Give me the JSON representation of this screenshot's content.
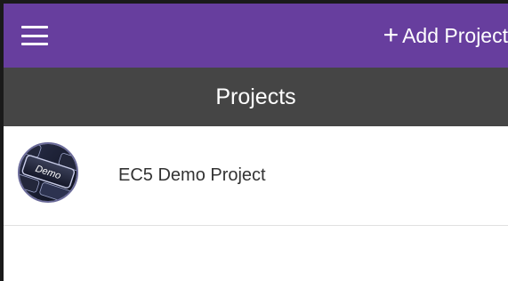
{
  "header": {
    "add_project_label": "Add Project",
    "add_icon": "plus-icon",
    "menu_icon": "hamburger-menu-icon"
  },
  "title_bar": {
    "title": "Projects"
  },
  "projects": [
    {
      "name": "EC5 Demo Project",
      "logo_text": "Demo"
    }
  ],
  "colors": {
    "app_bar": "#673e9e",
    "title_bar": "#454545"
  }
}
